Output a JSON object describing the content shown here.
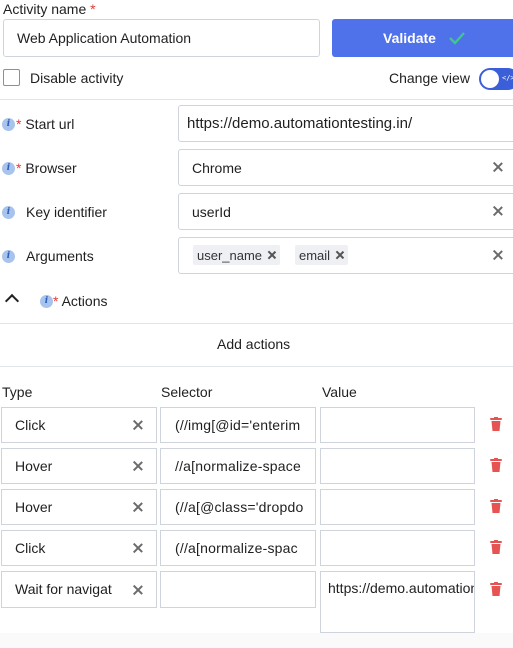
{
  "activity": {
    "name_label": "Activity name",
    "required_mark": "*",
    "name_value": "Web Application Automation",
    "validate_label": "Validate",
    "disable_label": "Disable activity",
    "change_view_label": "Change view",
    "toggle_tag": "</>"
  },
  "fields": {
    "start_url": {
      "label": "Start url",
      "value": "https://demo.automationtesting.in/"
    },
    "browser": {
      "label": "Browser",
      "value": "Chrome"
    },
    "key_identifier": {
      "label": "Key identifier",
      "value": "userId"
    },
    "arguments": {
      "label": "Arguments",
      "chips": [
        "user_name",
        "email"
      ]
    }
  },
  "actions": {
    "section_label": "Actions",
    "add_label": "Add actions",
    "columns": [
      "Type",
      "Selector",
      "Value"
    ],
    "rows": [
      {
        "type": "Click",
        "selector": "(//img[@id='enterim",
        "value": ""
      },
      {
        "type": "Hover",
        "selector": "//a[normalize-space",
        "value": ""
      },
      {
        "type": "Hover",
        "selector": "(//a[@class='dropdo",
        "value": ""
      },
      {
        "type": "Click",
        "selector": "(//a[normalize-spac",
        "value": ""
      },
      {
        "type": "Wait for navigat",
        "selector": "",
        "value": "https://demo.automationtesting.in/Static.html"
      }
    ]
  },
  "colors": {
    "accent": "#4f71ea",
    "required": "#e53935",
    "delete": "#e55353",
    "info": "#a8c4ec"
  },
  "icons": [
    "check-icon",
    "info-icon",
    "clear-icon",
    "chevron-up-icon",
    "trash-icon"
  ]
}
